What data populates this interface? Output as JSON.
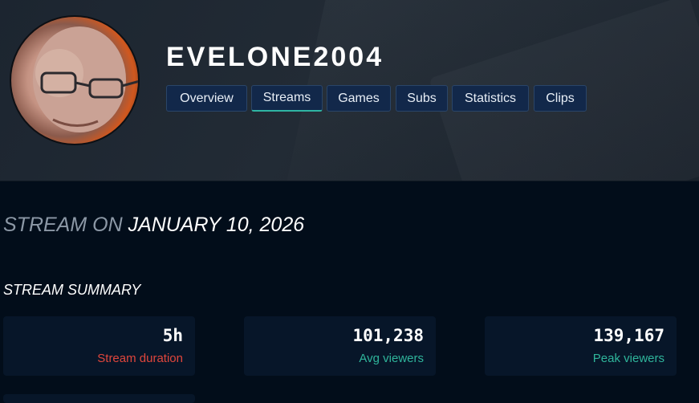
{
  "profile": {
    "username": "EVELONE2004",
    "avatar_alt": "channel avatar"
  },
  "nav": {
    "tabs": [
      {
        "label": "Overview",
        "active": false
      },
      {
        "label": "Streams",
        "active": true
      },
      {
        "label": "Games",
        "active": false
      },
      {
        "label": "Subs",
        "active": false
      },
      {
        "label": "Statistics",
        "active": false
      },
      {
        "label": "Clips",
        "active": false
      }
    ]
  },
  "stream": {
    "heading_prefix": "STREAM ON",
    "heading_date": "JANUARY 10, 2026"
  },
  "summary": {
    "title": "STREAM SUMMARY",
    "cards": [
      {
        "value": "5h",
        "label": "Stream duration",
        "color": "#e0463c"
      },
      {
        "value": "101,238",
        "label": "Avg viewers",
        "color": "#2fb59b"
      },
      {
        "value": "139,167",
        "label": "Peak viewers",
        "color": "#2fb59b"
      }
    ]
  },
  "colors": {
    "background": "#020d1a",
    "tab_bg": "#12284a",
    "tab_active_underline": "#2fb5a3",
    "card_bg": "#071629"
  }
}
